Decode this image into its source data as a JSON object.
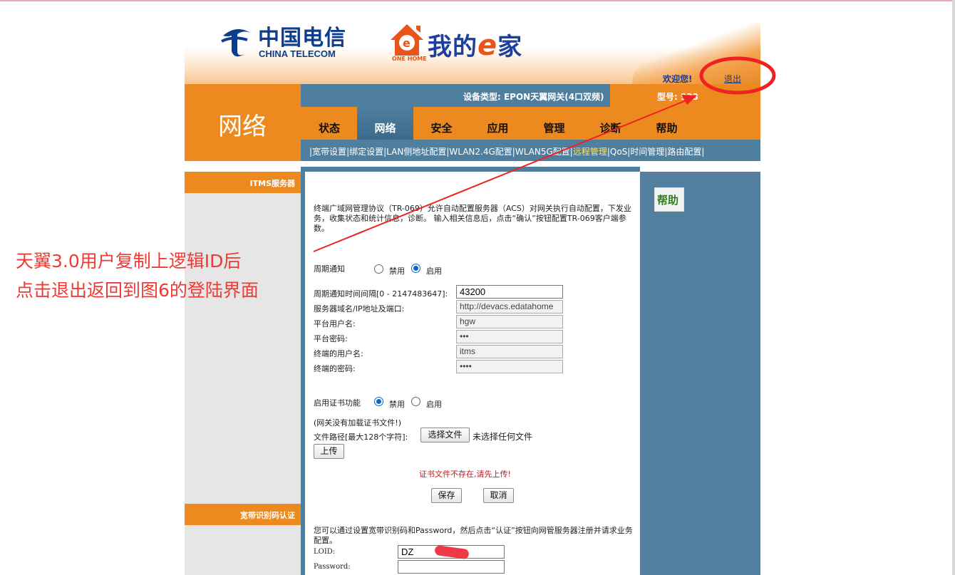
{
  "header": {
    "ct_logo_cn": "中国电信",
    "ct_logo_en": "CHINA TELECOM",
    "ehome_prefix": "我的",
    "ehome_e": "e",
    "ehome_suffix": "家",
    "ehome_house_text": "ONE HOME",
    "welcome": "欢迎您!",
    "logout": "退出"
  },
  "device_bar": {
    "device_type": "设备类型: EPON天翼网关(4口双频)",
    "model": "型号: ",
    "model_value": "923"
  },
  "section_title": "网络",
  "tabs": [
    {
      "label": "状态"
    },
    {
      "label": "网络"
    },
    {
      "label": "安全"
    },
    {
      "label": "应用"
    },
    {
      "label": "管理"
    },
    {
      "label": "诊断"
    },
    {
      "label": "帮助"
    }
  ],
  "subnav": [
    "宽带设置",
    "绑定设置",
    "LAN侧地址配置",
    "WLAN2.4G配置",
    "WLAN5G配置",
    "远程管理",
    "QoS",
    "时间管理",
    "路由配置"
  ],
  "left_headers": {
    "itms": "ITMS服务器",
    "loid": "宽带识别码认证"
  },
  "help": {
    "title": "帮助"
  },
  "itms": {
    "desc": "终端广域网管理协议（TR-069）允许自动配置服务器（ACS）对网关执行自动配置，下发业务，收集状态和统计信息，诊断。 输入相关信息后，点击“确认”按钮配置TR-069客户端参数。",
    "periodic_label": "周期通知",
    "disable": "禁用",
    "enable": "启用",
    "interval_label": "周期通知时间间隔[0 - 2147483647]:",
    "interval_value": "43200",
    "server_label": "服务器域名/IP地址及端口:",
    "server_value": "http://devacs.edatahome",
    "user_label": "平台用户名:",
    "user_value": "hgw",
    "pass_label": "平台密码:",
    "pass_value": "•••",
    "term_user_label": "终端的用户名:",
    "term_user_value": "itms",
    "term_pass_label": "终端的密码:",
    "term_pass_value": "••••",
    "cert_label": "启用证书功能",
    "no_cert": "(网关没有加载证书文件!)",
    "file_label": "文件路径[最大128个字符]:",
    "choose_file": "选择文件",
    "no_file": "未选择任何文件",
    "upload": "上传",
    "error": "证书文件不存在,请先上传!",
    "save": "保存",
    "cancel": "取消"
  },
  "loid": {
    "desc": "您可以通过设置宽带识别码和Password，然后点击“认证”按钮向网管服务器注册并请求业务配置。",
    "loid_label": "LOID:",
    "loid_value": "DZ",
    "password_label": "Password:",
    "password_value": ""
  },
  "annotation": {
    "line1": "天翼3.0用户复制上逻辑ID后",
    "line2": "点击退出返回到图6的登陆界面",
    "color": "#ee3a34"
  },
  "colors": {
    "orange": "#ec8a1f",
    "steel_blue": "#4f7f9f",
    "error_red": "#d0121b"
  }
}
